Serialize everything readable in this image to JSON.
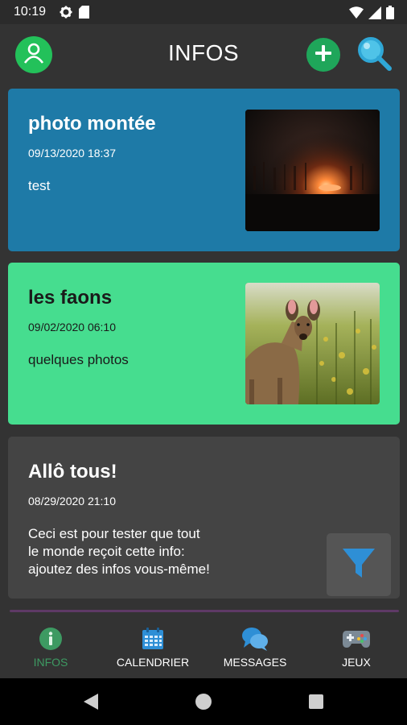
{
  "status_bar": {
    "time": "10:19",
    "icons": [
      "settings-icon",
      "sim-card-icon",
      "wifi-icon",
      "signal-icon",
      "battery-icon"
    ]
  },
  "app_bar": {
    "title": "INFOS",
    "icons": [
      "user-icon",
      "plus-icon",
      "search-icon"
    ],
    "colors": {
      "avatar": "#23c15a",
      "add": "#1fa65a",
      "search": "#4fc3e8"
    }
  },
  "cards": [
    {
      "title": "photo montée",
      "date": "09/13/2020 18:37",
      "body": "test",
      "has_image": true,
      "color": "#1e7aa7"
    },
    {
      "title": "les faons",
      "date": "09/02/2020 06:10",
      "body": "quelques photos",
      "has_image": true,
      "color": "#46dd8f"
    },
    {
      "title": "Allô tous!",
      "date": "08/29/2020 21:10",
      "body_lines": [
        "Ceci est pour tester que tout",
        "le monde reçoit cette info:",
        "ajoutez des infos vous-même!"
      ],
      "has_image": false,
      "color": "#444444"
    }
  ],
  "filter_button": {
    "icon": "filter-icon",
    "color": "#2e8fd6"
  },
  "bottom_nav": {
    "items": [
      {
        "label": "INFOS",
        "icon": "info-icon",
        "active": true
      },
      {
        "label": "CALENDRIER",
        "icon": "calendar-icon",
        "active": false
      },
      {
        "label": "MESSAGES",
        "icon": "chat-icon",
        "active": false
      },
      {
        "label": "JEUX",
        "icon": "gamepad-icon",
        "active": false
      }
    ],
    "active_color": "#3d9a62"
  },
  "system_nav": {
    "icons": [
      "back-icon",
      "home-icon",
      "recents-icon"
    ]
  }
}
